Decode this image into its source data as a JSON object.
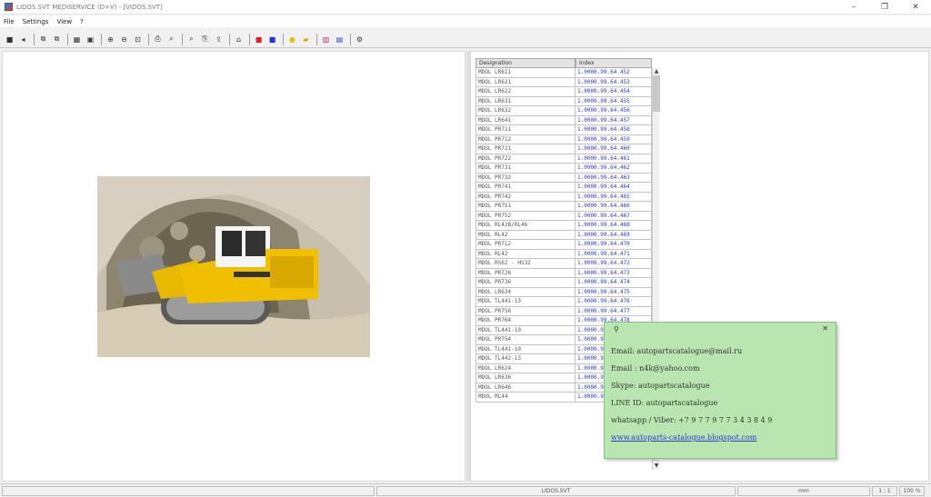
{
  "window": {
    "title": "LIDOS.SVT MEDISERVICE (D+V) - [VIDOS.SVT]",
    "minimize": "–",
    "maximize": "❐",
    "close": "✕"
  },
  "menu": [
    "File",
    "Settings",
    "View",
    "?"
  ],
  "toolbar": {
    "buttons": [
      {
        "name": "stop-icon",
        "glyph": "■"
      },
      {
        "name": "back-icon",
        "glyph": "◂"
      },
      {
        "name": "page-prev-icon",
        "glyph": "⧉"
      },
      {
        "name": "page-next-icon",
        "glyph": "⧉"
      },
      {
        "name": "grid-icon",
        "glyph": "▦"
      },
      {
        "name": "save-icon",
        "glyph": "▣"
      },
      {
        "name": "zoom-in-icon",
        "glyph": "⊕"
      },
      {
        "name": "zoom-out-icon",
        "glyph": "⊖"
      },
      {
        "name": "fit-icon",
        "glyph": "⊡"
      },
      {
        "name": "print-icon",
        "glyph": "⎙"
      },
      {
        "name": "find-icon",
        "glyph": "⌕"
      },
      {
        "name": "find-next-icon",
        "glyph": "⌕"
      },
      {
        "name": "copy-icon",
        "glyph": "⎘"
      },
      {
        "name": "export-icon",
        "glyph": "⇪"
      },
      {
        "name": "home-icon",
        "glyph": "⌂"
      },
      {
        "name": "red-square-icon",
        "glyph": "■",
        "color": "#e02020"
      },
      {
        "name": "blue-square-icon",
        "glyph": "■",
        "color": "#1f33d8"
      },
      {
        "name": "info-icon",
        "glyph": "●",
        "color": "#e8c000"
      },
      {
        "name": "folder-icon",
        "glyph": "▰",
        "color": "#d9a400"
      },
      {
        "name": "chart-icon",
        "glyph": "▥",
        "color": "#c03070"
      },
      {
        "name": "document-icon",
        "glyph": "▤",
        "color": "#3050c0"
      },
      {
        "name": "settings-icon",
        "glyph": "⚙"
      }
    ]
  },
  "grid": {
    "header_designation": "Designation",
    "header_index": "Index",
    "rows": [
      {
        "designation": "MDOL LR611",
        "index": "1.0000.99.64.452"
      },
      {
        "designation": "MDOL LR621",
        "index": "1.0000.99.64.453"
      },
      {
        "designation": "MDOL LR622",
        "index": "1.0000.99.64.454"
      },
      {
        "designation": "MDOL LR631",
        "index": "1.0000.99.64.455"
      },
      {
        "designation": "MDOL LR632",
        "index": "1.0000.99.64.456"
      },
      {
        "designation": "MDOL LR641",
        "index": "1.0000.99.64.457"
      },
      {
        "designation": "MDOL PR711",
        "index": "1.0000.99.64.458"
      },
      {
        "designation": "MDOL PR712",
        "index": "1.0000.99.64.459"
      },
      {
        "designation": "MDOL PR721",
        "index": "1.0000.99.64.460"
      },
      {
        "designation": "MDOL PR722",
        "index": "1.0000.99.64.461"
      },
      {
        "designation": "MDOL PR731",
        "index": "1.0000.99.64.462"
      },
      {
        "designation": "MDOL PR732",
        "index": "1.0000.99.64.463"
      },
      {
        "designation": "MDOL PR741",
        "index": "1.0000.99.64.464"
      },
      {
        "designation": "MDOL PR742",
        "index": "1.0000.99.64.465"
      },
      {
        "designation": "MDOL PR751",
        "index": "1.0000.99.64.466"
      },
      {
        "designation": "MDOL PR752",
        "index": "1.0000.99.64.467"
      },
      {
        "designation": "MDOL RL42B/RL46",
        "index": "1.0000.99.64.468"
      },
      {
        "designation": "MDOL RL42",
        "index": "1.0000.99.64.469"
      },
      {
        "designation": "MDOL PR712",
        "index": "1.0000.99.64.470"
      },
      {
        "designation": "MDOL RL42",
        "index": "1.0000.99.64.471"
      },
      {
        "designation": "MDOL RS62 - HS32",
        "index": "1.0000.99.64.472"
      },
      {
        "designation": "MDOL PR726",
        "index": "1.0000.99.64.473"
      },
      {
        "designation": "MDOL PR736",
        "index": "1.0000.99.64.474"
      },
      {
        "designation": "MDOL LR634",
        "index": "1.0000.99.64.475"
      },
      {
        "designation": "MDOL TL441-13",
        "index": "1.0000.99.64.476"
      },
      {
        "designation": "MDOL PR756",
        "index": "1.0000.99.64.477"
      },
      {
        "designation": "MDOL PR764",
        "index": "1.0000.99.64.478"
      },
      {
        "designation": "MDOL TL441-10",
        "index": "1.0000.99.64.479"
      },
      {
        "designation": "MDOL PR754",
        "index": "1.0000.99.64.480"
      },
      {
        "designation": "MDOL TL441-10",
        "index": "1.0000.99.64.481"
      },
      {
        "designation": "MDOL TL442-13",
        "index": "1.0000.99.64.482"
      },
      {
        "designation": "MDOL LR624",
        "index": "1.0000.99.64.483"
      },
      {
        "designation": "MDOL LR636",
        "index": "1.0000.99.64.484"
      },
      {
        "designation": "MDOL LR646",
        "index": "1.0000.99.64.485"
      },
      {
        "designation": "MDOL RL44",
        "index": "1.0000.99.64.486"
      }
    ]
  },
  "popup": {
    "pin_icon": "⚲",
    "close_icon": "✕",
    "email1": "Email: autopartscatalogue@mail.ru",
    "email2": "Email : n4k@yahoo.com",
    "skype": "Skype: autopartscatalogue",
    "line": "LINE ID: autopartscatalogue",
    "whatsapp": "whatsapp / Viber: +7 9 7 7 9 7 7 3 4 3 8 4 9",
    "link": "www.autoparts-catalogue.blogspot.com"
  },
  "status": {
    "panel1": "",
    "panel2": "LIDOS.SVT",
    "panel3": "mm",
    "panel4": "1 : 1",
    "panel5": "100 %"
  }
}
